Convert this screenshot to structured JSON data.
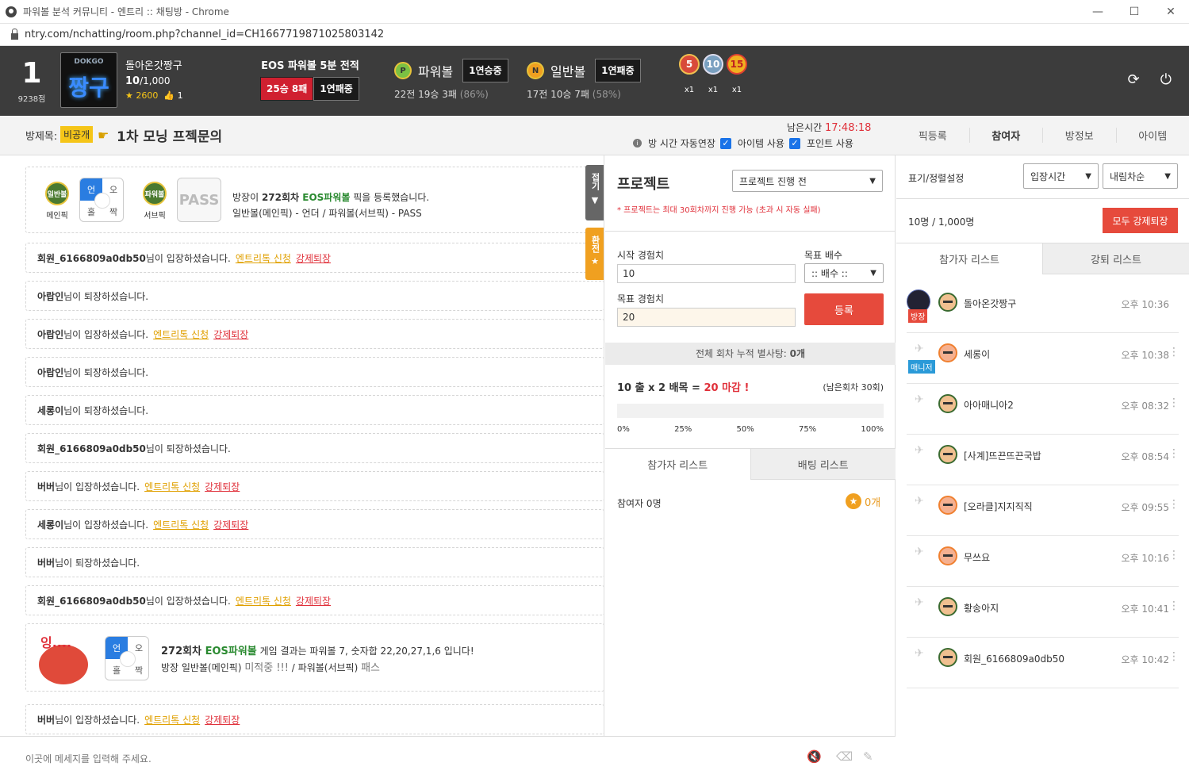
{
  "window": {
    "title": "파워볼 분석 커뮤니티 - 엔트리 :: 채팅방 - Chrome",
    "url": "ntry.com/nchatting/room.php?channel_id=CH1667719871025803142",
    "minimize": "—",
    "maximize": "☐",
    "close": "✕"
  },
  "header": {
    "rank": "1",
    "points": "9238점",
    "avatar_word": "DOKGO",
    "avatar_kr": "짱구",
    "username": "돌아온갓짱구",
    "level": "10",
    "level_max": "/1,000",
    "stars": "2600",
    "likes": "1",
    "eos": {
      "title": "EOS 파워볼 5분 전적",
      "record": "25승 8패",
      "streak": "1연패중"
    },
    "powerball": {
      "coin": "P",
      "name": "파워볼",
      "streak": "1연승중",
      "stats": "22전 19승 3패",
      "pct": "(86%)"
    },
    "normal": {
      "coin": "N",
      "name": "일반볼",
      "streak": "1연패중",
      "stats": "17전 10승 7패",
      "pct": "(58%)"
    },
    "medals": [
      {
        "n": "5",
        "c": "x1"
      },
      {
        "n": "10",
        "c": "x1"
      },
      {
        "n": "15",
        "c": "x1"
      }
    ],
    "refresh": "⟳",
    "power": "⏻"
  },
  "room": {
    "label": "방제목:",
    "privacy": "비공개",
    "title": "1차 모닝 프젝문의",
    "remain_label": "남은시간",
    "remain": "17:48:18",
    "auto_extend": "방 시간 자동연장",
    "item_use": "아이템 사용",
    "point_use": "포인트 사용",
    "tabs": [
      "픽등록",
      "참여자",
      "방정보",
      "아이템"
    ]
  },
  "chat": {
    "pick": {
      "main_ball": "일반볼",
      "main_label": "메인픽",
      "q": [
        "언",
        "오",
        "홀",
        "짝"
      ],
      "sub_ball": "파워볼",
      "sub_label": "서브픽",
      "pass": "PASS",
      "line1_a": "방장이 ",
      "line1_b": "272회차 ",
      "line1_c": "EOS파워볼",
      "line1_d": " 픽을 등록했습니다.",
      "line2": "일반볼(메인픽) - 언더 / 파워볼(서브픽) - PASS"
    },
    "fold": "접기",
    "switch": "환전",
    "messages": [
      {
        "user": "회원_6166809a0db50",
        "text": "님이 입장하셨습니다.",
        "a": "엔트리톡 신청",
        "b": "강제퇴장"
      },
      {
        "user": "아랍인",
        "text": "님이 퇴장하셨습니다.",
        "a": "",
        "b": ""
      },
      {
        "user": "아랍인",
        "text": "님이 입장하셨습니다.",
        "a": "엔트리톡 신청",
        "b": "강제퇴장"
      },
      {
        "user": "아랍인",
        "text": "님이 퇴장하셨습니다.",
        "a": "",
        "b": ""
      },
      {
        "user": "세롱이",
        "text": "님이 퇴장하셨습니다.",
        "a": "",
        "b": ""
      },
      {
        "user": "회원_6166809a0db50",
        "text": "님이 퇴장하셨습니다.",
        "a": "",
        "b": ""
      },
      {
        "user": "버버",
        "text": "님이 입장하셨습니다.",
        "a": "엔트리톡 신청",
        "b": "강제퇴장"
      },
      {
        "user": "세롱이",
        "text": "님이 입장하셨습니다.",
        "a": "엔트리톡 신청",
        "b": "강제퇴장"
      },
      {
        "user": "버버",
        "text": "님이 퇴장하셨습니다.",
        "a": "",
        "b": ""
      },
      {
        "user": "회원_6166809a0db50",
        "text": "님이 입장하셨습니다.",
        "a": "엔트리톡 신청",
        "b": "강제퇴장"
      }
    ],
    "result": {
      "emote": "잉....",
      "q": [
        "언",
        "오",
        "홀",
        "짝"
      ],
      "round": "272회차 ",
      "game": "EOS파워볼",
      "t1": " 게임 결과는 파워볼 7, 숫자합 22,20,27,1,6 입니다!",
      "t2a": "방장 일반볼(메인픽) ",
      "t2b": "미적중 !!!",
      "t2c": " / 파워볼(서브픽) ",
      "t2d": "패스"
    },
    "last": {
      "user": "버버",
      "text": "님이 입장하셨습니다.",
      "a": "엔트리톡 신청",
      "b": "강제퇴장"
    },
    "placeholder": "이곳에 메세지를 입력해 주세요."
  },
  "project": {
    "title": "프로젝트",
    "status": "프로젝트 진행 전",
    "note": "* 프로젝트는 최대 30회차까지 진행 가능 (초과 시 자동 실패)",
    "start_label": "시작 경험치",
    "start_val": "10",
    "mult_label": "목표 배수",
    "mult_val": ":: 배수 ::",
    "target_label": "목표 경험치",
    "target_val": "20",
    "register": "등록",
    "total": "전체 회차 누적 별사탕: ",
    "total_val": "0개",
    "calc_a": "10 출 x 2 배목 = ",
    "calc_b": "20 마감 !",
    "remain": "(남은회차 30회)",
    "progress": 0,
    "ticks": [
      "0%",
      "25%",
      "50%",
      "75%",
      "100%"
    ],
    "tabs": [
      "참가자 리스트",
      "배팅 리스트"
    ],
    "participants": "참여자 0명",
    "star": "★",
    "star_count": "0개"
  },
  "users": {
    "sort_label": "표기/정렬설정",
    "sort1": "입장시간",
    "sort2": "내림차순",
    "count": "10명",
    "count_max": " / 1,000명",
    "kick_all": "모두 강제퇴장",
    "tabs": [
      "참가자 리스트",
      "강퇴 리스트"
    ],
    "list": [
      {
        "name": "돌아온갓짱구",
        "time": "오후 10:36",
        "role": "방장",
        "new": false
      },
      {
        "name": "세롱이",
        "time": "오후 10:38",
        "role": "매니저",
        "new": true
      },
      {
        "name": "아아매니아2",
        "time": "오후 08:32",
        "role": "",
        "new": false
      },
      {
        "name": "[사계]뜨끈뜨끈국밥",
        "time": "오후 08:54",
        "role": "",
        "new": false
      },
      {
        "name": "[오라클]지지직직",
        "time": "오후 09:55",
        "role": "",
        "new": true
      },
      {
        "name": "무쓰요",
        "time": "오후 10:16",
        "role": "",
        "new": true
      },
      {
        "name": "황송아지",
        "time": "오후 10:41",
        "role": "",
        "new": false
      },
      {
        "name": "회원_6166809a0db50",
        "time": "오후 10:42",
        "role": "",
        "new": false
      }
    ]
  },
  "colors": {
    "accent_red": "#e64a3c",
    "blue": "#2a7de1",
    "gold": "#f5c518"
  }
}
